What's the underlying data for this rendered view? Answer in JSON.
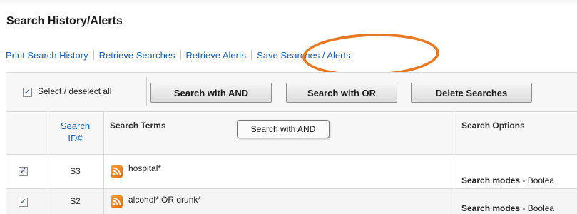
{
  "title": "Search History/Alerts",
  "links": {
    "print": "Print Search History",
    "retrieve_searches": "Retrieve Searches",
    "retrieve_alerts": "Retrieve Alerts",
    "save": "Save Searches / Alerts"
  },
  "toolbar": {
    "select_all_label": "Select / deselect all",
    "select_all_checked": true,
    "and_button": "Search with AND",
    "or_button": "Search with OR",
    "delete_button": "Delete Searches"
  },
  "table": {
    "headers": {
      "search_id": "Search ID#",
      "search_terms": "Search Terms",
      "search_options": "Search Options"
    },
    "rows": [
      {
        "checked": true,
        "id": "S3",
        "terms": "hospital*",
        "options_label": "Search modes",
        "options_value": " - Boolea"
      },
      {
        "checked": true,
        "id": "S2",
        "terms": "alcohol* OR drunk*",
        "options_label": "Search modes",
        "options_value": " - Boolea"
      }
    ]
  },
  "tooltip": "Search with AND",
  "colors": {
    "link": "#1a5fb4",
    "highlight": "#e87722",
    "rss": "#f08a24"
  },
  "icons": {
    "row_feed": "rss-feed-icon",
    "checkbox": "checkbox-icon"
  }
}
